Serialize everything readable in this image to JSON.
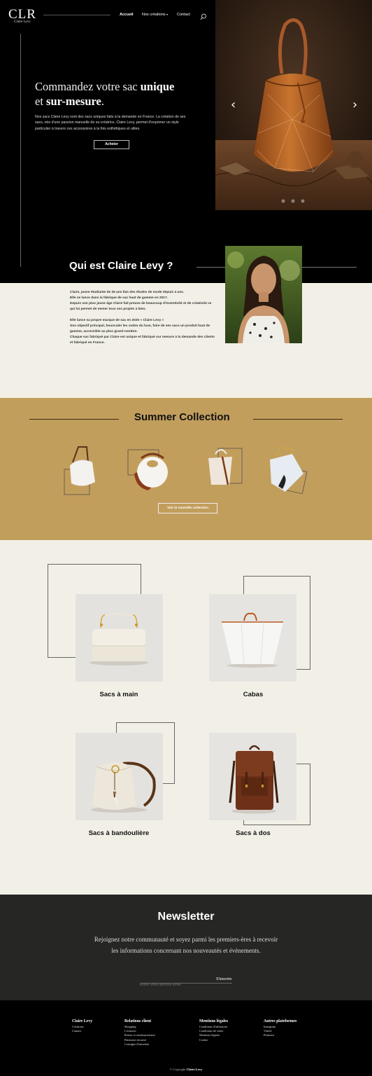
{
  "brand": {
    "logo": "CLR",
    "name": "Claire Levy"
  },
  "nav": {
    "home": "Accueil",
    "creations": "Nos créations",
    "contact": "Contact"
  },
  "hero": {
    "title_1": "Commandez votre sac",
    "title_bold_1": "unique",
    "title_2": "et",
    "title_bold_2": "sur-mesure",
    "title_end": ".",
    "body": "Nos sacs Claire Levy sont des sacs uniques faits à la demande en France. La création de ses sacs, née d'une passion manuelle de sa créatrice, Claire Levy, permet d'exprimer un style particulier à travers ces accessoires à la fois esthétiques et utiles.",
    "cta": "Acheter",
    "carousel_dots": 3
  },
  "about": {
    "title": "Qui est Claire Levy ?",
    "lines": [
      "Claire, jeune étudiante de 25 ans fais des études de mode depuis 4 ans.",
      "Elle se lance dans la fabrique de sac haut de gamme en 2017.",
      "Depuis son plus jeune âge Claire fait preuve de beaucoup d'inventivité et de créativité ce qui lui permet de mener tous ses projets à bien.",
      "",
      "Elle lance sa propre marque de sac en 2020 « Claire Levy »",
      "Son objectif principal, bousculer les codes du luxe, faire de ses sacs un produit haut de gamme, accessible au plus grand nombre.",
      "Chaque sac fabriqué par Claire est unique et fabriqué sur mesure à la demande des clients et fabriqué en France."
    ]
  },
  "summer": {
    "title": "Summer Collection",
    "cta": "Voir la nouvelle collection"
  },
  "categories": {
    "handbags": "Sacs à main",
    "totes": "Cabas",
    "crossbody": "Sacs à bandoulière",
    "backpacks": "Sacs à dos"
  },
  "newsletter": {
    "title": "Newsletter",
    "body": "Rejoignez notre communauté et soyez parmi les premiers-ères à recevoir les informations concernant nos nouveautés et évènements.",
    "placeholder": "Entrer votre adresse email",
    "submit": "S'inscrire"
  },
  "footer": {
    "col1": {
      "title": "Claire Levy",
      "links": [
        "Créations",
        "Contact"
      ]
    },
    "col2": {
      "title": "Relations client",
      "links": [
        "Shopping",
        "Livraison",
        "Retour et remboursement",
        "Paiement sécurisé",
        "Consigne d'entretien"
      ]
    },
    "col3": {
      "title": "Mentions légales",
      "links": [
        "Conditions d'utilisation",
        "Conditions de vente",
        "Mentions légales",
        "Cookie"
      ]
    },
    "col4": {
      "title": "Autres plateformes",
      "links": [
        "Instagram",
        "Vinted",
        "Pinterest"
      ]
    },
    "copyright": "© Copyright",
    "copyright_brand": "Claire Levy"
  },
  "colors": {
    "hero_bg": "#000000",
    "cream": "#f2f0e6",
    "gold": "#c29e5d",
    "newsletter_bg": "#262624",
    "leather": "#a85a24"
  }
}
